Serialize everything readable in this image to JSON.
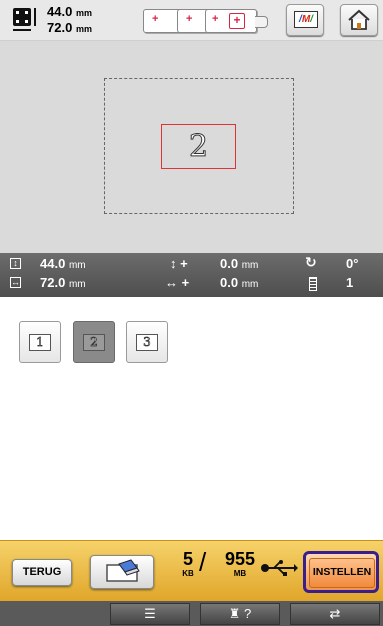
{
  "top": {
    "height_value": "44.0",
    "height_unit": "mm",
    "width_value": "72.0",
    "width_unit": "mm",
    "hoop_plus": "+",
    "icons": {
      "size": "embroidery-size-icon",
      "thread": "thread-color-display-icon",
      "home": "home-icon"
    },
    "thread_screen": [
      "M",
      "W"
    ]
  },
  "pattern_preview": {
    "digit": "2",
    "frame_color": "#e03333"
  },
  "info": {
    "height": "44.0",
    "width": "72.0",
    "unit": "mm",
    "v_plus": "+",
    "h_plus": "+",
    "y_offset": "0.0",
    "x_offset": "0.0",
    "rotation": "0°",
    "thread_count": "1"
  },
  "patterns": [
    {
      "label": "1",
      "selected": false
    },
    {
      "label": "2",
      "selected": true
    },
    {
      "label": "3",
      "selected": false
    }
  ],
  "bottom": {
    "back_label": "TERUG",
    "memory_used": "5",
    "memory_used_unit": "KB",
    "memory_total": "955",
    "memory_total_unit": "MB",
    "slash": "/",
    "set_label": "INSTELLEN",
    "accent": "#3a1f8c"
  },
  "footer": {
    "list_icon": "☰",
    "help_label": "?",
    "change_icon": "⇄"
  }
}
